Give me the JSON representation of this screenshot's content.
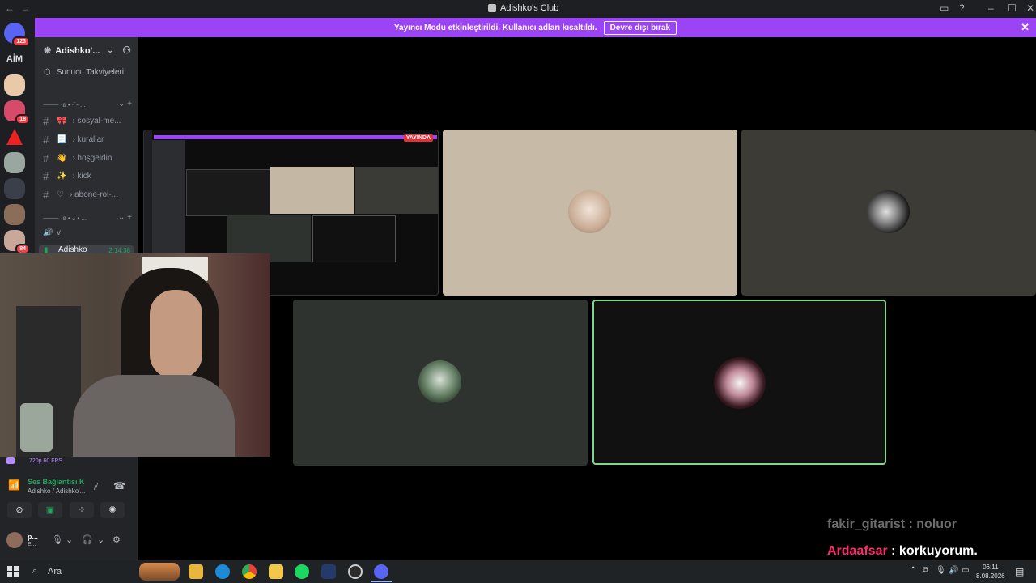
{
  "window": {
    "title": "Adishko's Club"
  },
  "banner": {
    "message": "Yayıncı Modu etkinleştirildi. Kullanıcı adları kısaltıldı.",
    "button": "Devre dışı bırak"
  },
  "guilds": {
    "home_badge": "123",
    "aim_label": "AİM",
    "badge_18": "18",
    "badge_84": "84"
  },
  "sidebar": {
    "server_name": "Adishko'...",
    "boosts": "Sunucu Takviyeleri",
    "category1": "⸻ ·ʚ • ᵕ̈ - ...",
    "channels": [
      {
        "emoji": "🎀",
        "name": "› sosyal-me..."
      },
      {
        "emoji": "📃",
        "name": "› kurallar"
      },
      {
        "emoji": "👋",
        "name": "› hoşgeldin"
      },
      {
        "emoji": "✨",
        "name": "› kick"
      },
      {
        "emoji": "♡",
        "name": "› abone-rol-..."
      }
    ],
    "category2": "⸻ ·ʚ • ᴗ • ...",
    "voice_channel": "v",
    "live_user": "Adishko",
    "live_time": "2:14:38"
  },
  "stream": {
    "live_badge": "YAYINDA",
    "quality": "720p 60 FPS"
  },
  "voice_panel": {
    "status": "Ses Bağlantısı K",
    "location": "Adishko / Adishko'..."
  },
  "user_panel": {
    "name": "p...",
    "status": "E..."
  },
  "chat": [
    {
      "user": "fakir_gitarist",
      "sep": " : ",
      "message": "noluor",
      "user_color": "#6b6b6b",
      "msg_color": "#6b6b6b"
    },
    {
      "user": "Ardaafsar",
      "sep": " : ",
      "message": "korkuyorum.",
      "user_color": "#ff2a6d",
      "msg_color": "#ffffff"
    }
  ],
  "taskbar": {
    "search_placeholder": "Ara",
    "time": "06:11",
    "date": "8.08.2026"
  },
  "icons": {
    "start": "windows-start-icon",
    "search": "search-icon",
    "gear": "gear-icon",
    "headphones": "headphones-icon",
    "mic": "microphone-icon"
  },
  "colors": {
    "accent": "#9b44f5",
    "online": "#23a55a",
    "speaking": "#7fd68a"
  }
}
